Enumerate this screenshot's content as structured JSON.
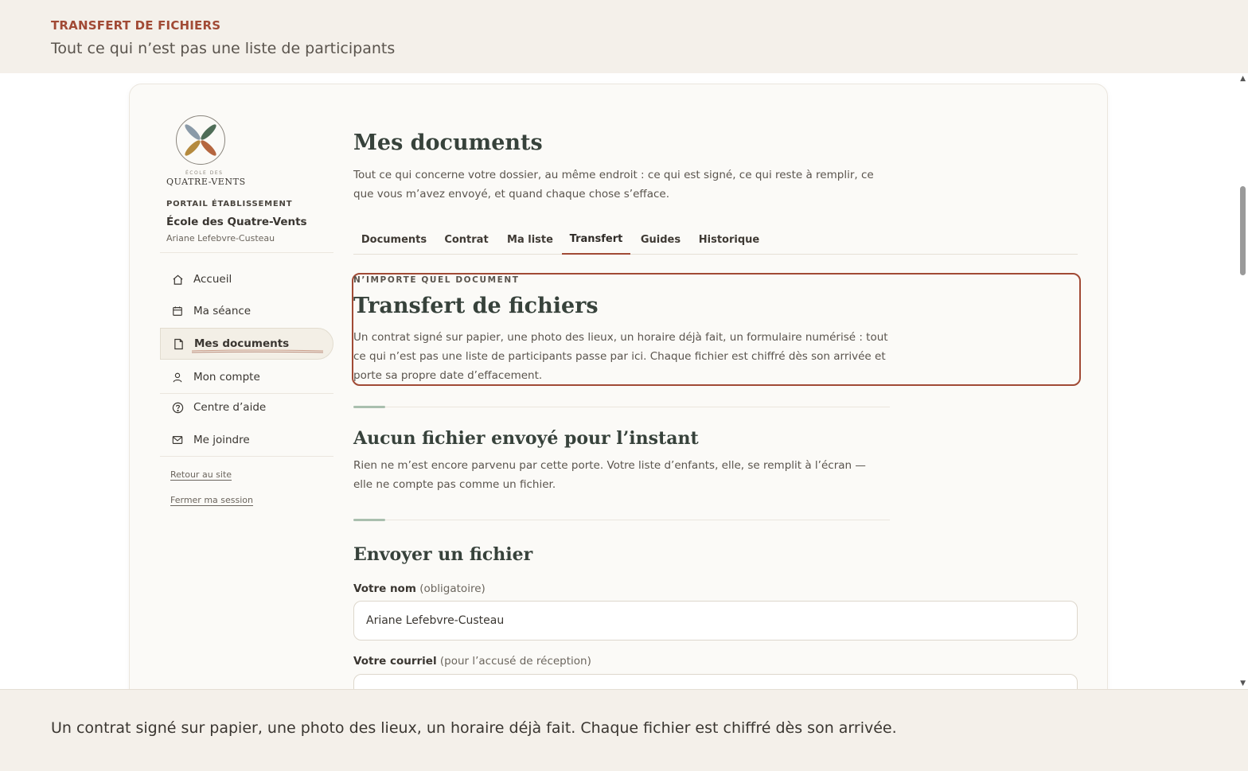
{
  "banner": {
    "eyebrow": "TRANSFERT DE FICHIERS",
    "subtitle": "Tout ce qui n’est pas une liste de participants"
  },
  "sidebar": {
    "logo_small": "ÉCOLE DES",
    "logo_name": "QUATRE-VENTS",
    "portal_label": "PORTAIL ÉTABLISSEMENT",
    "school_name": "École des Quatre-Vents",
    "user_name": "Ariane Lefebvre-Custeau",
    "nav": [
      {
        "label": "Accueil",
        "icon": "home-icon"
      },
      {
        "label": "Ma séance",
        "icon": "calendar-icon"
      },
      {
        "label": "Mes documents",
        "icon": "document-icon",
        "active": true
      },
      {
        "label": "Mon compte",
        "icon": "user-icon"
      },
      {
        "label": "Centre d’aide",
        "icon": "help-icon"
      },
      {
        "label": "Me joindre",
        "icon": "mail-icon"
      }
    ],
    "links": {
      "back": "Retour au site",
      "logout": "Fermer ma session"
    }
  },
  "main": {
    "title": "Mes documents",
    "intro": "Tout ce qui concerne votre dossier, au même endroit : ce qui est signé, ce qui reste à remplir, ce que vous m’avez envoyé, et quand chaque chose s’efface.",
    "tabs": [
      "Documents",
      "Contrat",
      "Ma liste",
      "Transfert",
      "Guides",
      "Historique"
    ],
    "active_tab": "Transfert",
    "section": {
      "eyebrow": "N’IMPORTE QUEL DOCUMENT",
      "title": "Transfert de fichiers",
      "body": "Un contrat signé sur papier, une photo des lieux, un horaire déjà fait, un formulaire numérisé : tout ce qui n’est pas une liste de participants passe par ici. Chaque fichier est chiffré dès son arrivée et porte sa propre date d’effacement."
    },
    "empty": {
      "title": "Aucun fichier envoyé pour l’instant",
      "body": "Rien ne m’est encore parvenu par cette porte. Votre liste d’enfants, elle, se remplit à l’écran — elle ne compte pas comme un fichier."
    },
    "upload": {
      "title": "Envoyer un fichier",
      "name_label": "Votre nom",
      "name_hint": "(obligatoire)",
      "name_value": "Ariane Lefebvre-Custeau",
      "email_label": "Votre courriel",
      "email_hint": "(pour l’accusé de réception)",
      "email_value": ""
    }
  },
  "caption": "Un contrat signé sur papier, une photo des lieux, un horaire déjà fait. Chaque fichier est chiffré dès son arrivée.",
  "colors": {
    "accent": "#a14a35",
    "heading": "#37423b",
    "background": "#f4f0ea",
    "card": "#fbfaf7",
    "rule_accent": "#a9bfae"
  }
}
